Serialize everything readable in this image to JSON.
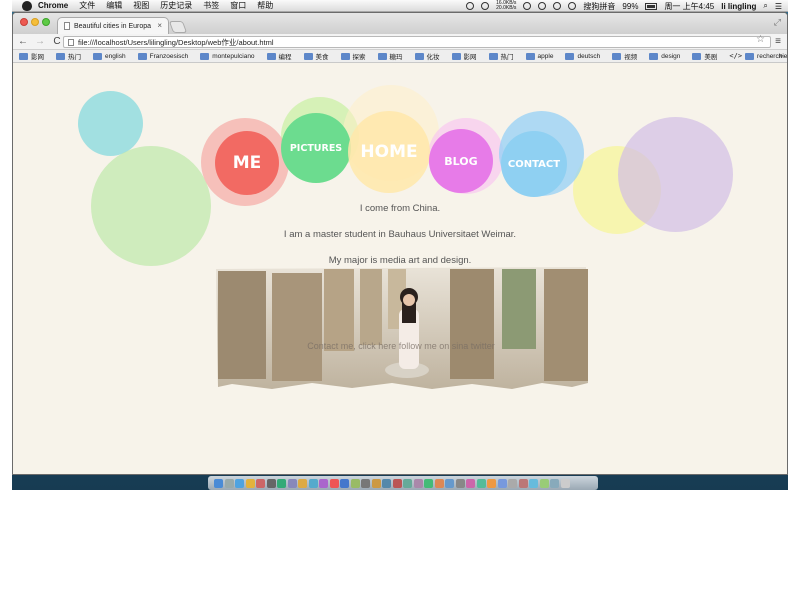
{
  "menubar": {
    "app_name": "Chrome",
    "items": [
      "文件",
      "编辑",
      "视图",
      "历史记录",
      "书签",
      "窗口",
      "帮助"
    ],
    "net_up": "16.0KB/s",
    "net_down": "20.0KB/s",
    "input_method": "搜狗拼音",
    "battery": "99%",
    "clock": "周一 上午4:45",
    "user": "li lingling"
  },
  "browser": {
    "tab_title": "Beautiful cities in Europa",
    "tab_close": "×",
    "url": "file:///localhost/Users/lilingling/Desktop/web作业/about.html",
    "bookmarks": [
      "影网",
      "热门",
      "english",
      "Franzoesisch",
      "montepulciano",
      "编程",
      "美食",
      "探索",
      "糖玛",
      "化妆",
      "影网",
      "热门",
      "apple",
      "deutsch",
      "视频",
      "design",
      "美剧",
      "recherchieren"
    ],
    "bookmarks_more": "»"
  },
  "page": {
    "nav": {
      "me": "ME",
      "pictures": "PICTURES",
      "home": "HOME",
      "blog": "BLOG",
      "contact": "CONTACT"
    },
    "intro": [
      "I come from China.",
      "I am a master student in Bauhaus Universitaet Weimar.",
      "My major is media art and design."
    ],
    "photo_caption": "Contact me, click here follow me on sina twitter"
  },
  "colors": {
    "page_bg": "#f7f3ea",
    "me": "#f26a63",
    "pictures": "#6cdc8f",
    "home": "#ffe6a8",
    "blog": "#e77be8",
    "contact": "#8fd0f2"
  }
}
